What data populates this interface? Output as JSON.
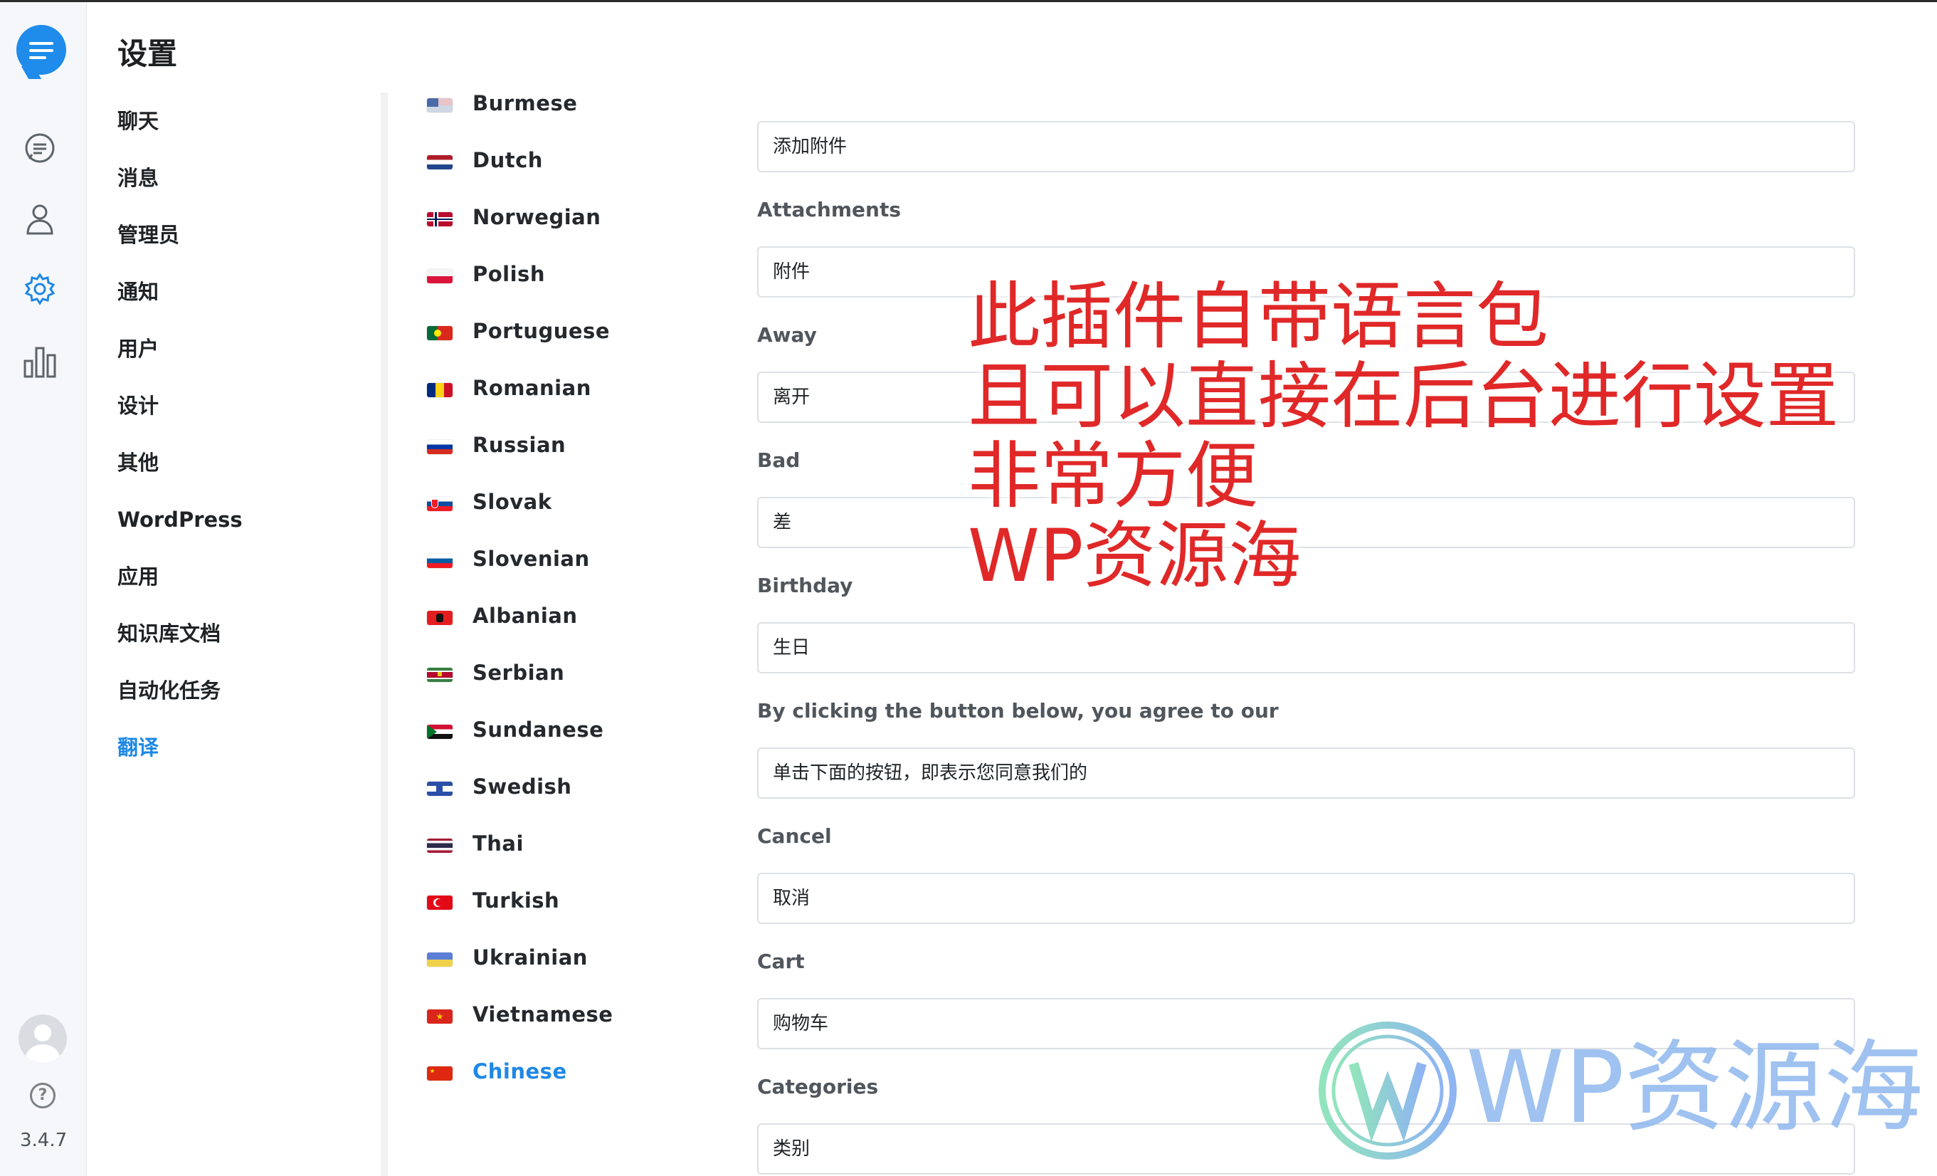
{
  "page": {
    "title": "设置",
    "version": "3.4.7"
  },
  "nav": [
    "聊天",
    "消息",
    "管理员",
    "通知",
    "用户",
    "设计",
    "其他",
    "WordPress",
    "应用",
    "知识库文档",
    "自动化任务",
    "翻译"
  ],
  "active_nav": "翻译",
  "languages": [
    {
      "name": "Burmese",
      "flag": "burmese-flag"
    },
    {
      "name": "Dutch",
      "flag": "dutch-flag"
    },
    {
      "name": "Norwegian",
      "flag": "norwegian-flag"
    },
    {
      "name": "Polish",
      "flag": "polish-flag"
    },
    {
      "name": "Portuguese",
      "flag": "portuguese-flag"
    },
    {
      "name": "Romanian",
      "flag": "romanian-flag"
    },
    {
      "name": "Russian",
      "flag": "russian-flag"
    },
    {
      "name": "Slovak",
      "flag": "slovak-flag"
    },
    {
      "name": "Slovenian",
      "flag": "slovenian-flag"
    },
    {
      "name": "Albanian",
      "flag": "albanian-flag"
    },
    {
      "name": "Serbian",
      "flag": "serbian-flag"
    },
    {
      "name": "Sundanese",
      "flag": "sundanese-flag"
    },
    {
      "name": "Swedish",
      "flag": "swedish-flag"
    },
    {
      "name": "Thai",
      "flag": "thai-flag"
    },
    {
      "name": "Turkish",
      "flag": "turkish-flag"
    },
    {
      "name": "Ukrainian",
      "flag": "ukrainian-flag"
    },
    {
      "name": "Vietnamese",
      "flag": "vietnamese-flag"
    },
    {
      "name": "Chinese",
      "flag": "chinese-flag"
    }
  ],
  "active_language": "Chinese",
  "translations": {
    "top_value": "添加附件",
    "items": [
      {
        "label": "Attachments",
        "value": "附件"
      },
      {
        "label": "Away",
        "value": "离开"
      },
      {
        "label": "Bad",
        "value": "差"
      },
      {
        "label": "Birthday",
        "value": "生日"
      },
      {
        "label": "By clicking the button below, you agree to our",
        "value": "单击下面的按钮，即表示您同意我们的"
      },
      {
        "label": "Cancel",
        "value": "取消"
      },
      {
        "label": "Cart",
        "value": "购物车"
      },
      {
        "label": "Categories",
        "value": "类别"
      }
    ]
  },
  "overlay_note": [
    "此插件自带语言包",
    "且可以直接在后台进行设置",
    "非常方便",
    "WP资源海"
  ],
  "watermark": "WP资源海",
  "colors": {
    "accent": "#1e88e5",
    "note": "#e02828",
    "rail_bg": "#f5f7fa"
  }
}
